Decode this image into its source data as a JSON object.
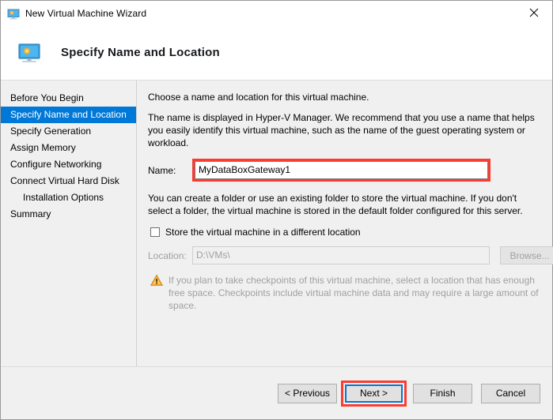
{
  "window": {
    "title": "New Virtual Machine Wizard",
    "icon": "virtual-machine-icon",
    "close_label": "✕"
  },
  "header": {
    "title": "Specify Name and Location",
    "icon": "virtual-machine-icon"
  },
  "sidebar": {
    "items": [
      {
        "label": "Before You Begin",
        "selected": false,
        "indent": false
      },
      {
        "label": "Specify Name and Location",
        "selected": true,
        "indent": false
      },
      {
        "label": "Specify Generation",
        "selected": false,
        "indent": false
      },
      {
        "label": "Assign Memory",
        "selected": false,
        "indent": false
      },
      {
        "label": "Configure Networking",
        "selected": false,
        "indent": false
      },
      {
        "label": "Connect Virtual Hard Disk",
        "selected": false,
        "indent": false
      },
      {
        "label": "Installation Options",
        "selected": false,
        "indent": true
      },
      {
        "label": "Summary",
        "selected": false,
        "indent": false
      }
    ]
  },
  "main": {
    "intro_text": "Choose a name and location for this virtual machine.",
    "description_text": "The name is displayed in Hyper-V Manager. We recommend that you use a name that helps you easily identify this virtual machine, such as the name of the guest operating system or workload.",
    "name_label": "Name:",
    "name_value": "MyDataBoxGateway1",
    "folder_text": "You can create a folder or use an existing folder to store the virtual machine. If you don't select a folder, the virtual machine is stored in the default folder configured for this server.",
    "checkbox_label": "Store the virtual machine in a different location",
    "checkbox_checked": false,
    "location_label": "Location:",
    "location_value": "D:\\VMs\\",
    "browse_label": "Browse...",
    "warning_text": "If you plan to take checkpoints of this virtual machine, select a location that has enough free space. Checkpoints include virtual machine data and may require a large amount of space.",
    "warning_icon": "warning-triangle-icon"
  },
  "footer": {
    "previous_label": "< Previous",
    "next_label": "Next >",
    "finish_label": "Finish",
    "cancel_label": "Cancel"
  },
  "colors": {
    "selection_blue": "#0078d7",
    "highlight_red": "#fd3b30",
    "focus_blue": "#0078d7",
    "disabled_gray": "#a0a0a0",
    "window_background": "#f0f0f0"
  }
}
